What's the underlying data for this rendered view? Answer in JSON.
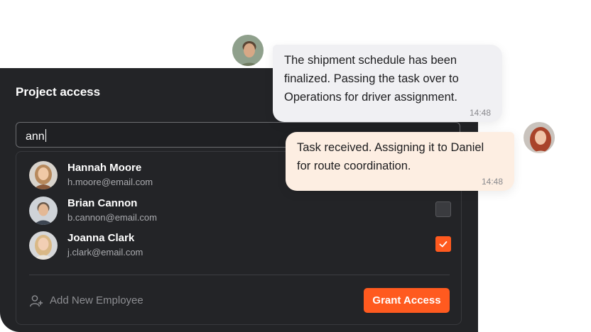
{
  "panel": {
    "title": "Project access",
    "search": {
      "value": "ann"
    },
    "employees": [
      {
        "name": "Hannah Moore",
        "email": "h.moore@email.com",
        "checked": false,
        "checkbox_visible": false
      },
      {
        "name": "Brian Cannon",
        "email": "b.cannon@email.com",
        "checked": false,
        "checkbox_visible": true
      },
      {
        "name": "Joanna Clark",
        "email": "j.clark@email.com",
        "checked": true,
        "checkbox_visible": true
      }
    ],
    "add_employee_label": "Add New Employee",
    "grant_button_label": "Grant Access"
  },
  "chat": {
    "messages": [
      {
        "text_lines": [
          "The shipment schedule has been",
          "finalized. Passing the task over to",
          "Operations for driver assignment."
        ],
        "time": "14:48"
      },
      {
        "text_lines": [
          "Task received. Assigning it to Daniel",
          "for route coordination."
        ],
        "time": "14:48"
      }
    ]
  },
  "colors": {
    "accent": "#ff5a1f",
    "panel_bg": "#232427"
  }
}
